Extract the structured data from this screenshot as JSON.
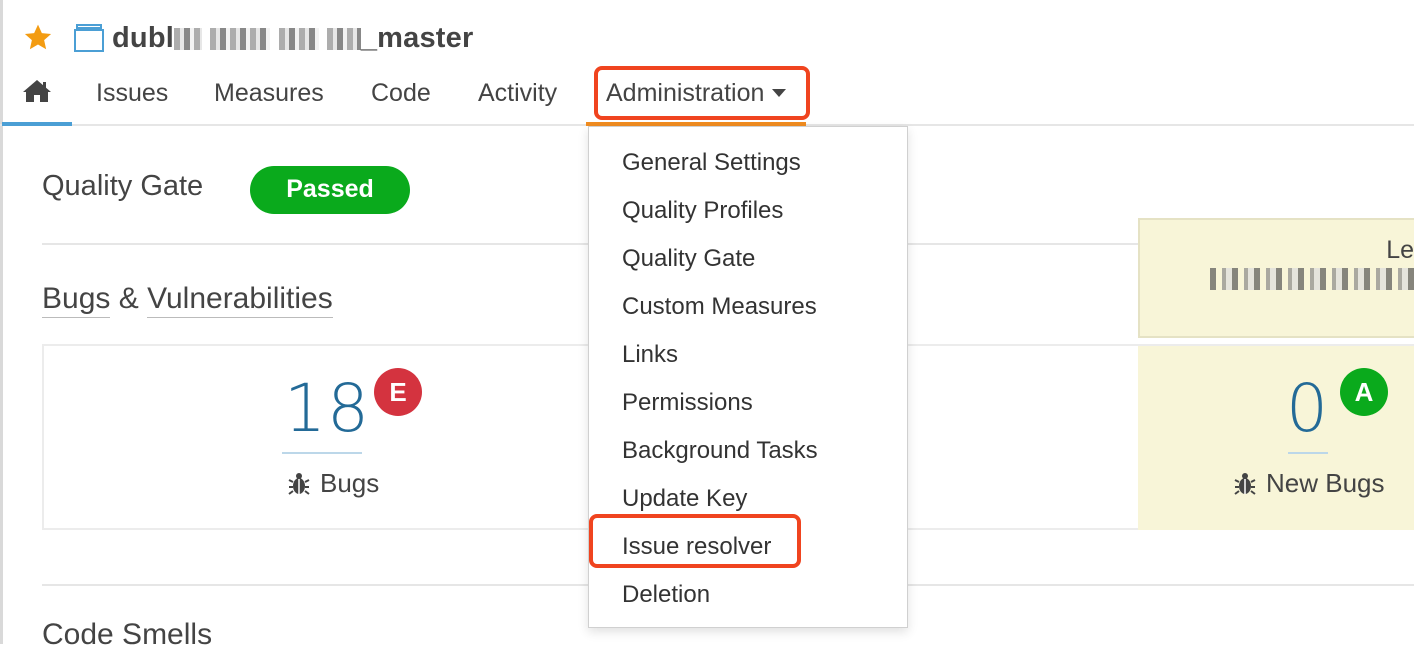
{
  "project": {
    "name_prefix": "dubl",
    "name_suffix": "_master",
    "star_icon": "star-icon",
    "project_icon": "project-icon"
  },
  "nav": {
    "home_icon": "home-icon",
    "items": [
      "Issues",
      "Measures",
      "Code",
      "Activity"
    ],
    "admin_label": "Administration"
  },
  "quality_gate": {
    "title": "Quality Gate",
    "status": "Passed",
    "status_color": "#0aaa1c"
  },
  "bugs_section": {
    "title_part1": "Bugs",
    "title_amp": " & ",
    "title_part2": "Vulnerabilities",
    "bugs_value": "18",
    "bugs_rating": "E",
    "bugs_rating_color": "#d4333f",
    "bugs_label": "Bugs",
    "leak_label": "Le",
    "new_bugs_value": "0",
    "new_bugs_rating": "A",
    "new_bugs_rating_color": "#0aaa1c",
    "new_bugs_label": "New Bugs"
  },
  "next_section_title": "Code Smells",
  "dropdown": {
    "items": [
      "General Settings",
      "Quality Profiles",
      "Quality Gate",
      "Custom Measures",
      "Links",
      "Permissions",
      "Background Tasks",
      "Update Key",
      "Issue resolver",
      "Deletion"
    ]
  },
  "colors": {
    "highlight": "#f0441f",
    "accent_blue": "#4b9fd5",
    "accent_orange": "#f08c20",
    "leak_bg": "#f8f5d8"
  }
}
